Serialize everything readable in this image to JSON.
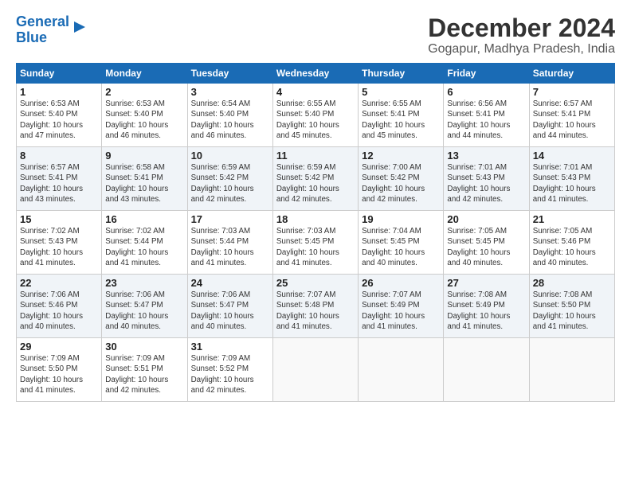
{
  "logo": {
    "line1": "General",
    "line2": "Blue"
  },
  "title": "December 2024",
  "subtitle": "Gogapur, Madhya Pradesh, India",
  "weekdays": [
    "Sunday",
    "Monday",
    "Tuesday",
    "Wednesday",
    "Thursday",
    "Friday",
    "Saturday"
  ],
  "weeks": [
    [
      {
        "day": "1",
        "info": "Sunrise: 6:53 AM\nSunset: 5:40 PM\nDaylight: 10 hours\nand 47 minutes."
      },
      {
        "day": "2",
        "info": "Sunrise: 6:53 AM\nSunset: 5:40 PM\nDaylight: 10 hours\nand 46 minutes."
      },
      {
        "day": "3",
        "info": "Sunrise: 6:54 AM\nSunset: 5:40 PM\nDaylight: 10 hours\nand 46 minutes."
      },
      {
        "day": "4",
        "info": "Sunrise: 6:55 AM\nSunset: 5:40 PM\nDaylight: 10 hours\nand 45 minutes."
      },
      {
        "day": "5",
        "info": "Sunrise: 6:55 AM\nSunset: 5:41 PM\nDaylight: 10 hours\nand 45 minutes."
      },
      {
        "day": "6",
        "info": "Sunrise: 6:56 AM\nSunset: 5:41 PM\nDaylight: 10 hours\nand 44 minutes."
      },
      {
        "day": "7",
        "info": "Sunrise: 6:57 AM\nSunset: 5:41 PM\nDaylight: 10 hours\nand 44 minutes."
      }
    ],
    [
      {
        "day": "8",
        "info": "Sunrise: 6:57 AM\nSunset: 5:41 PM\nDaylight: 10 hours\nand 43 minutes."
      },
      {
        "day": "9",
        "info": "Sunrise: 6:58 AM\nSunset: 5:41 PM\nDaylight: 10 hours\nand 43 minutes."
      },
      {
        "day": "10",
        "info": "Sunrise: 6:59 AM\nSunset: 5:42 PM\nDaylight: 10 hours\nand 42 minutes."
      },
      {
        "day": "11",
        "info": "Sunrise: 6:59 AM\nSunset: 5:42 PM\nDaylight: 10 hours\nand 42 minutes."
      },
      {
        "day": "12",
        "info": "Sunrise: 7:00 AM\nSunset: 5:42 PM\nDaylight: 10 hours\nand 42 minutes."
      },
      {
        "day": "13",
        "info": "Sunrise: 7:01 AM\nSunset: 5:43 PM\nDaylight: 10 hours\nand 42 minutes."
      },
      {
        "day": "14",
        "info": "Sunrise: 7:01 AM\nSunset: 5:43 PM\nDaylight: 10 hours\nand 41 minutes."
      }
    ],
    [
      {
        "day": "15",
        "info": "Sunrise: 7:02 AM\nSunset: 5:43 PM\nDaylight: 10 hours\nand 41 minutes."
      },
      {
        "day": "16",
        "info": "Sunrise: 7:02 AM\nSunset: 5:44 PM\nDaylight: 10 hours\nand 41 minutes."
      },
      {
        "day": "17",
        "info": "Sunrise: 7:03 AM\nSunset: 5:44 PM\nDaylight: 10 hours\nand 41 minutes."
      },
      {
        "day": "18",
        "info": "Sunrise: 7:03 AM\nSunset: 5:45 PM\nDaylight: 10 hours\nand 41 minutes."
      },
      {
        "day": "19",
        "info": "Sunrise: 7:04 AM\nSunset: 5:45 PM\nDaylight: 10 hours\nand 40 minutes."
      },
      {
        "day": "20",
        "info": "Sunrise: 7:05 AM\nSunset: 5:45 PM\nDaylight: 10 hours\nand 40 minutes."
      },
      {
        "day": "21",
        "info": "Sunrise: 7:05 AM\nSunset: 5:46 PM\nDaylight: 10 hours\nand 40 minutes."
      }
    ],
    [
      {
        "day": "22",
        "info": "Sunrise: 7:06 AM\nSunset: 5:46 PM\nDaylight: 10 hours\nand 40 minutes."
      },
      {
        "day": "23",
        "info": "Sunrise: 7:06 AM\nSunset: 5:47 PM\nDaylight: 10 hours\nand 40 minutes."
      },
      {
        "day": "24",
        "info": "Sunrise: 7:06 AM\nSunset: 5:47 PM\nDaylight: 10 hours\nand 40 minutes."
      },
      {
        "day": "25",
        "info": "Sunrise: 7:07 AM\nSunset: 5:48 PM\nDaylight: 10 hours\nand 41 minutes."
      },
      {
        "day": "26",
        "info": "Sunrise: 7:07 AM\nSunset: 5:49 PM\nDaylight: 10 hours\nand 41 minutes."
      },
      {
        "day": "27",
        "info": "Sunrise: 7:08 AM\nSunset: 5:49 PM\nDaylight: 10 hours\nand 41 minutes."
      },
      {
        "day": "28",
        "info": "Sunrise: 7:08 AM\nSunset: 5:50 PM\nDaylight: 10 hours\nand 41 minutes."
      }
    ],
    [
      {
        "day": "29",
        "info": "Sunrise: 7:09 AM\nSunset: 5:50 PM\nDaylight: 10 hours\nand 41 minutes."
      },
      {
        "day": "30",
        "info": "Sunrise: 7:09 AM\nSunset: 5:51 PM\nDaylight: 10 hours\nand 42 minutes."
      },
      {
        "day": "31",
        "info": "Sunrise: 7:09 AM\nSunset: 5:52 PM\nDaylight: 10 hours\nand 42 minutes."
      },
      {
        "day": "",
        "info": ""
      },
      {
        "day": "",
        "info": ""
      },
      {
        "day": "",
        "info": ""
      },
      {
        "day": "",
        "info": ""
      }
    ]
  ]
}
